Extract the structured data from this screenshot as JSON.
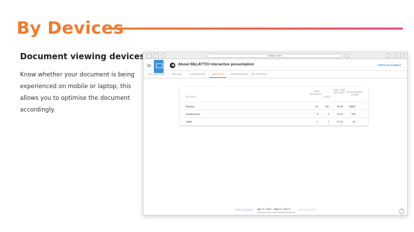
{
  "slide": {
    "title": "By Devices",
    "subheading": "Document viewing devices",
    "description": "Know whether your document is being experienced on mobile or laptop, this allows you to optimise the document accordingly."
  },
  "browser": {
    "url": "relayto.com",
    "doc_title": "About RELAYTO/ interactive presentation",
    "open_label": "OPEN DOCUMENT",
    "tabs": [
      {
        "label": "BY CONTENT"
      },
      {
        "label": "BY DAY"
      },
      {
        "label": "LOCATIONS"
      },
      {
        "label": "DEVICES",
        "active": true
      },
      {
        "label": "REFERRERS"
      },
      {
        "label": "BY PEOPLE"
      }
    ],
    "table": {
      "headers": [
        "DEVICES",
        "VIEW SESSIONS",
        "VISITS",
        "AVG. TIME PER VISIT",
        "ENGAGEMENT SCORE",
        "AVG. PAGES PER VISIT",
        "AVG. PAGES PER VISIT"
      ],
      "rows": [
        {
          "device": "Desktop",
          "sessions": "51",
          "visits": "161",
          "avg_time": "00:38",
          "engagement": "15689",
          "pages": "90",
          "score": "1303"
        },
        {
          "device": "Smartphones",
          "sessions": "8",
          "visits": "9",
          "avg_time": "14:23",
          "engagement": "398",
          "pages": "21",
          "score": "100"
        },
        {
          "device": "Tablet",
          "sessions": "1",
          "visits": "1",
          "avg_time": "07:04",
          "engagement": "64",
          "pages": "95",
          "score": "96"
        }
      ]
    },
    "footer": {
      "prev": "PREV 15 DAYS",
      "range": "Apr 27, 2017 - May 11, 2017",
      "next": "NEXT 15 DAYS"
    }
  }
}
